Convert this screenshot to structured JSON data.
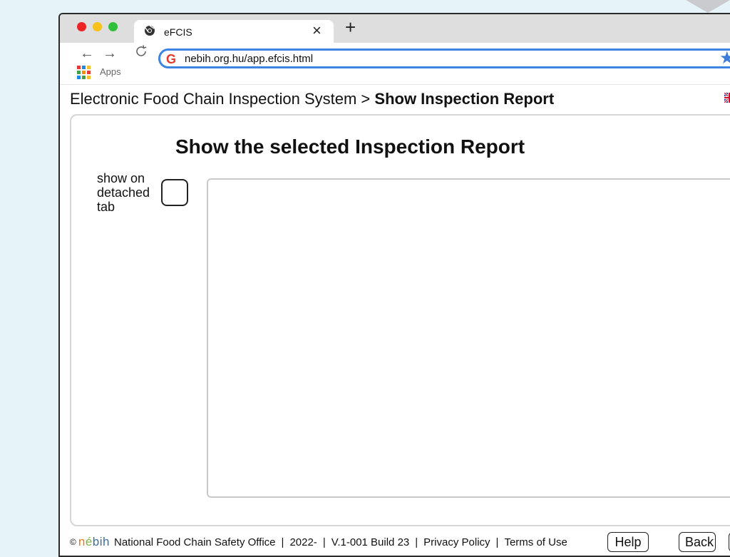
{
  "browser": {
    "tab": {
      "title": "eFCIS",
      "close": "×"
    },
    "new_tab": "+",
    "nav": {
      "back": "←",
      "forward": "→",
      "reload": "C"
    },
    "apps_label": "Apps",
    "url": "nebih.org.hu/app.efcis.html",
    "google_icon": "G",
    "bookmark_star": "★"
  },
  "breadcrumb": {
    "root": "Electronic Food Chain Inspection System",
    "separator": " > ",
    "current": "Show Inspection Report"
  },
  "main": {
    "title": "Show the selected Inspection Report",
    "detached_label": "show on detached tab",
    "detached_checked": false
  },
  "footer": {
    "copyright": "©",
    "logo": "nébih",
    "org": "National Food Chain Safety Office",
    "year": "2022-",
    "version": "V.1-001 Build 23",
    "privacy": "Privacy Policy",
    "terms": "Terms of Use",
    "divider": "|",
    "help": "Help",
    "back": "Back"
  },
  "colors": {
    "background": "#e6f4fa",
    "omnibox_border": "#3c83e3",
    "traffic_red": "#ed2224",
    "traffic_yellow": "#f8c21a",
    "traffic_green": "#2fbf3a"
  },
  "icons": [
    "chrome-icon",
    "close-icon",
    "plus-icon",
    "back-arrow-icon",
    "forward-arrow-icon",
    "reload-icon",
    "apps-grid-icon",
    "google-icon",
    "star-icon",
    "uk-flag-icon",
    "nebih-logo"
  ]
}
